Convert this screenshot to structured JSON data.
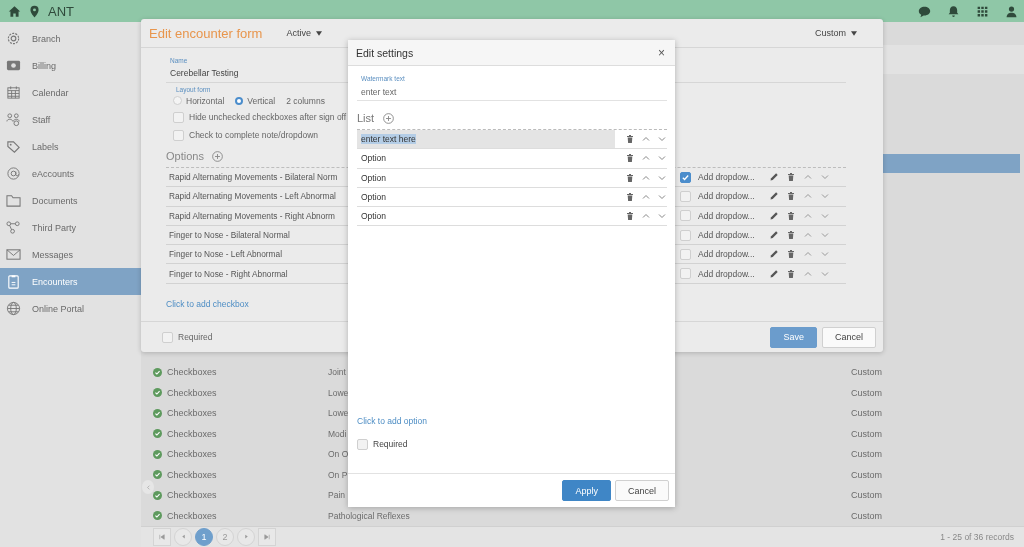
{
  "top_bar": {
    "title": "ANT"
  },
  "sidebar": {
    "items": [
      {
        "label": "Branch",
        "selected": false
      },
      {
        "label": "Billing",
        "selected": false
      },
      {
        "label": "Calendar",
        "selected": false
      },
      {
        "label": "Staff",
        "selected": false
      },
      {
        "label": "Labels",
        "selected": false
      },
      {
        "label": "eAccounts",
        "selected": false
      },
      {
        "label": "Documents",
        "selected": false
      },
      {
        "label": "Third Party",
        "selected": false
      },
      {
        "label": "Messages",
        "selected": false
      },
      {
        "label": "Encounters",
        "selected": true
      },
      {
        "label": "Online Portal",
        "selected": false
      }
    ]
  },
  "table": {
    "rows": [
      {
        "type": "Checkboxes",
        "name": "Joint",
        "category": "Custom"
      },
      {
        "type": "Checkboxes",
        "name": "Lowe",
        "category": "Custom"
      },
      {
        "type": "Checkboxes",
        "name": "Lowe",
        "category": "Custom"
      },
      {
        "type": "Checkboxes",
        "name": "Modi",
        "category": "Custom"
      },
      {
        "type": "Checkboxes",
        "name": "On O",
        "category": "Custom"
      },
      {
        "type": "Checkboxes",
        "name": "On P",
        "category": "Custom"
      },
      {
        "type": "Checkboxes",
        "name": "Pain",
        "category": "Custom"
      },
      {
        "type": "Checkboxes",
        "name": "Pathological Reflexes",
        "category": "Custom"
      }
    ]
  },
  "pager": {
    "pages": [
      {
        "label": "1",
        "selected": true
      },
      {
        "label": "2",
        "selected": false
      }
    ],
    "summary": "1 - 25 of 36 records"
  },
  "encounter_form": {
    "title": "Edit encounter form",
    "status": "Active",
    "type": "Custom",
    "name_label": "Name",
    "name": "Cerebellar Testing",
    "layout_label": "Layout form",
    "layouts": [
      {
        "label": "Horizontal",
        "selected": false
      },
      {
        "label": "Vertical",
        "selected": true
      }
    ],
    "columns": "2 columns",
    "settings": [
      {
        "label": "Hide unchecked checkboxes after sign off",
        "checked": false
      },
      {
        "label": "Check to complete note/dropdown",
        "checked": false
      }
    ],
    "options_label": "Options",
    "options": [
      {
        "label": "Rapid Alternating Movements - Bilateral Norm",
        "checked": true,
        "dropdown": "Add dropdow..."
      },
      {
        "label": "Rapid Alternating Movements - Left Abnormal",
        "checked": false,
        "dropdown": "Add dropdow..."
      },
      {
        "label": "Rapid Alternating Movements - Right Abnorm",
        "checked": false,
        "dropdown": "Add dropdow..."
      },
      {
        "label": "Finger to Nose - Bilateral Normal",
        "checked": false,
        "dropdown": "Add dropdow..."
      },
      {
        "label": "Finger to Nose - Left Abnormal",
        "checked": false,
        "dropdown": "Add dropdow..."
      },
      {
        "label": "Finger to Nose - Right Abnormal",
        "checked": false,
        "dropdown": "Add dropdow..."
      }
    ],
    "add_link": "Click to add checkbox",
    "required": {
      "label": "Required",
      "checked": false
    },
    "buttons": [
      "Save",
      "Cancel"
    ]
  },
  "settings_dialog": {
    "title": "Edit settings",
    "close": "×",
    "watermark": {
      "label": "Watermark text",
      "placeholder": "enter text"
    },
    "list_label": "List",
    "items": [
      {
        "text": "enter text here",
        "selected": true
      },
      {
        "text": "Option",
        "selected": false
      },
      {
        "text": "Option",
        "selected": false
      },
      {
        "text": "Option",
        "selected": false
      },
      {
        "text": "Option",
        "selected": false
      }
    ],
    "add_link": "Click to add option",
    "required": {
      "label": "Required",
      "checked": false
    },
    "buttons": [
      "Apply",
      "Cancel"
    ]
  }
}
